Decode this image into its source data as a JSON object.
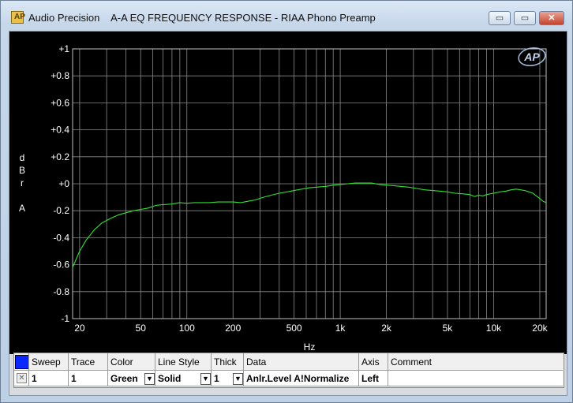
{
  "window": {
    "app_name": "Audio Precision",
    "chart_title": "A-A EQ FREQUENCY RESPONSE - RIAA Phono Preamp",
    "minimize_glyph": "▭",
    "maximize_glyph": "▭",
    "close_glyph": "✕"
  },
  "chart_data": {
    "type": "line",
    "title": "A-A EQ FREQUENCY RESPONSE - RIAA Phono Preamp",
    "xlabel": "Hz",
    "ylabel_lines": [
      "d",
      "B",
      "r",
      "A"
    ],
    "xscale": "log",
    "xlim": [
      18,
      22000
    ],
    "ylim": [
      -1,
      1
    ],
    "grid": true,
    "logo": "AP",
    "x_ticks": [
      {
        "value": 20,
        "label": "20"
      },
      {
        "value": 50,
        "label": "50"
      },
      {
        "value": 100,
        "label": "100"
      },
      {
        "value": 200,
        "label": "200"
      },
      {
        "value": 500,
        "label": "500"
      },
      {
        "value": 1000,
        "label": "1k"
      },
      {
        "value": 2000,
        "label": "2k"
      },
      {
        "value": 5000,
        "label": "5k"
      },
      {
        "value": 10000,
        "label": "10k"
      },
      {
        "value": 20000,
        "label": "20k"
      }
    ],
    "y_ticks": [
      {
        "value": 1,
        "label": "+1"
      },
      {
        "value": 0.8,
        "label": "+0.8"
      },
      {
        "value": 0.6,
        "label": "+0.6"
      },
      {
        "value": 0.4,
        "label": "+0.4"
      },
      {
        "value": 0.2,
        "label": "+0.2"
      },
      {
        "value": 0,
        "label": "+0"
      },
      {
        "value": -0.2,
        "label": "-0.2"
      },
      {
        "value": -0.4,
        "label": "-0.4"
      },
      {
        "value": -0.6,
        "label": "-0.6"
      },
      {
        "value": -0.8,
        "label": "-0.8"
      },
      {
        "value": -1,
        "label": "-1"
      }
    ],
    "series": [
      {
        "color": "#33e033",
        "x": [
          18,
          20,
          22,
          25,
          28,
          32,
          36,
          40,
          45,
          50,
          56,
          63,
          70,
          80,
          90,
          100,
          112,
          125,
          140,
          160,
          180,
          200,
          225,
          250,
          280,
          315,
          355,
          400,
          450,
          500,
          560,
          630,
          700,
          800,
          900,
          1000,
          1120,
          1250,
          1400,
          1600,
          1800,
          2000,
          2250,
          2500,
          2800,
          3150,
          3550,
          4000,
          4500,
          5000,
          5600,
          6300,
          7000,
          7500,
          8000,
          8500,
          9000,
          10000,
          11000,
          12000,
          13000,
          14000,
          15000,
          16000,
          17000,
          18000,
          19000,
          20000,
          21000,
          22000
        ],
        "y": [
          -0.62,
          -0.5,
          -0.42,
          -0.34,
          -0.29,
          -0.255,
          -0.23,
          -0.215,
          -0.2,
          -0.19,
          -0.18,
          -0.16,
          -0.155,
          -0.15,
          -0.14,
          -0.145,
          -0.14,
          -0.14,
          -0.14,
          -0.135,
          -0.135,
          -0.135,
          -0.14,
          -0.13,
          -0.12,
          -0.1,
          -0.085,
          -0.07,
          -0.06,
          -0.05,
          -0.04,
          -0.03,
          -0.025,
          -0.02,
          -0.01,
          -0.005,
          0,
          0.005,
          0.005,
          0.005,
          -0.005,
          -0.01,
          -0.015,
          -0.02,
          -0.025,
          -0.035,
          -0.045,
          -0.05,
          -0.055,
          -0.06,
          -0.07,
          -0.075,
          -0.08,
          -0.095,
          -0.085,
          -0.09,
          -0.08,
          -0.07,
          -0.06,
          -0.055,
          -0.045,
          -0.04,
          -0.045,
          -0.05,
          -0.06,
          -0.07,
          -0.09,
          -0.11,
          -0.13,
          -0.14
        ]
      }
    ]
  },
  "trace_table": {
    "headers": [
      "Sweep",
      "Trace",
      "Color",
      "Line Style",
      "Thick",
      "Data",
      "Axis",
      "Comment"
    ],
    "row": {
      "sweep": "1",
      "trace": "1",
      "color": "Green",
      "line_style": "Solid",
      "thick": "1",
      "data": "Anlr.Level A!Normalize",
      "axis": "Left",
      "comment": ""
    },
    "dropdown_glyph": "▼",
    "checkbox_glyph": "✕"
  }
}
